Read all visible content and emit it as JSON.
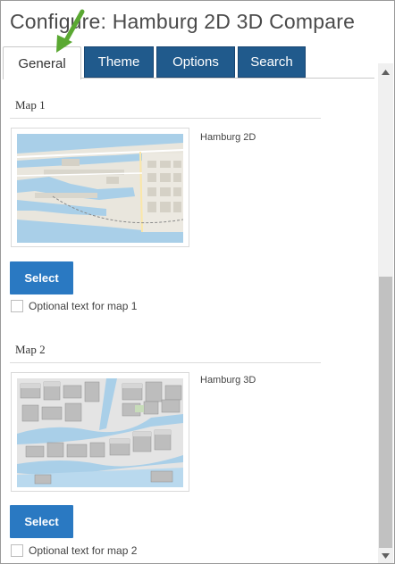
{
  "title": "Configure: Hamburg 2D 3D Compare",
  "tabs": [
    {
      "label": "General",
      "active": true
    },
    {
      "label": "Theme",
      "active": false
    },
    {
      "label": "Options",
      "active": false
    },
    {
      "label": "Search",
      "active": false
    }
  ],
  "maps": [
    {
      "section_label": "Map 1",
      "name": "Hamburg 2D",
      "select_label": "Select",
      "optional_text": "Optional text for map 1"
    },
    {
      "section_label": "Map 2",
      "name": "Hamburg 3D",
      "select_label": "Select",
      "optional_text": "Optional text for map 2"
    }
  ],
  "colors": {
    "tab_blue": "#205a8c",
    "button_blue": "#2a79c2",
    "arrow_green": "#5aa832",
    "water": "#a9cfe8"
  },
  "icons": {
    "annotation": "green-arrow-icon",
    "scroll_up": "triangle-up-icon",
    "scroll_down": "triangle-down-icon"
  }
}
